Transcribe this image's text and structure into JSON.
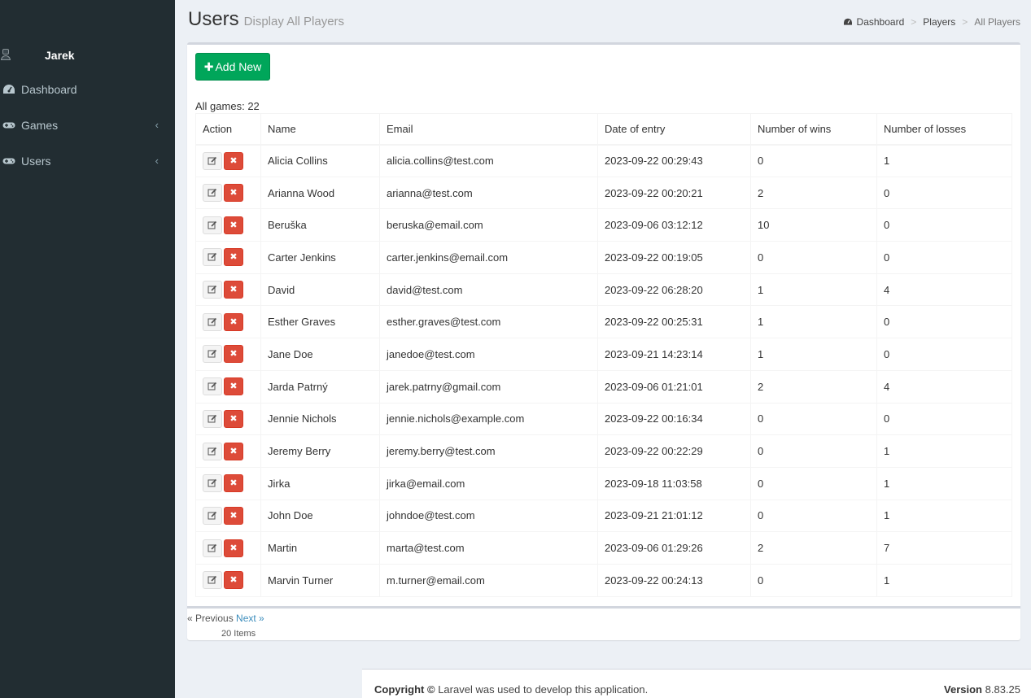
{
  "sidebar": {
    "user_name": "Jarek",
    "menu": [
      {
        "label": "Dashboard",
        "icon": "dashboard-icon",
        "has_children": false
      },
      {
        "label": "Games",
        "icon": "gamepad-icon",
        "has_children": true
      },
      {
        "label": "Users",
        "icon": "gamepad-icon",
        "has_children": true
      }
    ],
    "chevron": "‹"
  },
  "header": {
    "title": "Users",
    "subtitle": "Display All Players",
    "breadcrumb": {
      "home": "Dashboard",
      "sep": ">",
      "section": "Players",
      "current": "All Players"
    }
  },
  "toolbar": {
    "add_label": "Add New",
    "add_icon": "plus-icon"
  },
  "summary": {
    "all_games_label": "All games:",
    "all_games_count": "22"
  },
  "table": {
    "columns": [
      "Action",
      "Name",
      "Email",
      "Date of entry",
      "Number of wins",
      "Number of losses"
    ],
    "rows": [
      {
        "name": "Alicia Collins",
        "email": "alicia.collins@test.com",
        "date": "2023-09-22 00:29:43",
        "wins": "0",
        "losses": "1"
      },
      {
        "name": "Arianna Wood",
        "email": "arianna@test.com",
        "date": "2023-09-22 00:20:21",
        "wins": "2",
        "losses": "0"
      },
      {
        "name": "Beruška",
        "email": "beruska@email.com",
        "date": "2023-09-06 03:12:12",
        "wins": "10",
        "losses": "0"
      },
      {
        "name": "Carter Jenkins",
        "email": "carter.jenkins@email.com",
        "date": "2023-09-22 00:19:05",
        "wins": "0",
        "losses": "0"
      },
      {
        "name": "David",
        "email": "david@test.com",
        "date": "2023-09-22 06:28:20",
        "wins": "1",
        "losses": "4"
      },
      {
        "name": "Esther Graves",
        "email": "esther.graves@test.com",
        "date": "2023-09-22 00:25:31",
        "wins": "1",
        "losses": "0"
      },
      {
        "name": "Jane Doe",
        "email": "janedoe@test.com",
        "date": "2023-09-21 14:23:14",
        "wins": "1",
        "losses": "0"
      },
      {
        "name": "Jarda Patrný",
        "email": "jarek.patrny@gmail.com",
        "date": "2023-09-06 01:21:01",
        "wins": "2",
        "losses": "4"
      },
      {
        "name": "Jennie Nichols",
        "email": "jennie.nichols@example.com",
        "date": "2023-09-22 00:16:34",
        "wins": "0",
        "losses": "0"
      },
      {
        "name": "Jeremy Berry",
        "email": "jeremy.berry@test.com",
        "date": "2023-09-22 00:22:29",
        "wins": "0",
        "losses": "1"
      },
      {
        "name": "Jirka",
        "email": "jirka@email.com",
        "date": "2023-09-18 11:03:58",
        "wins": "0",
        "losses": "1"
      },
      {
        "name": "John Doe",
        "email": "johndoe@test.com",
        "date": "2023-09-21 21:01:12",
        "wins": "0",
        "losses": "1"
      },
      {
        "name": "Martin",
        "email": "marta@test.com",
        "date": "2023-09-06 01:29:26",
        "wins": "2",
        "losses": "7"
      },
      {
        "name": "Marvin Turner",
        "email": "m.turner@email.com",
        "date": "2023-09-22 00:24:13",
        "wins": "0",
        "losses": "1"
      }
    ]
  },
  "pagination": {
    "prev": "« Previous",
    "next": "Next »",
    "items": "20 Items"
  },
  "footer": {
    "copyright_label": "Copyright ©",
    "copyright_text": "Laravel was used to develop this application.",
    "version_label": "Version",
    "version_value": "8.83.25"
  },
  "colors": {
    "sidebar_bg": "#222d32",
    "accent_green": "#00a65a",
    "danger_red": "#dd4b39",
    "link_blue": "#3c8dbc"
  }
}
